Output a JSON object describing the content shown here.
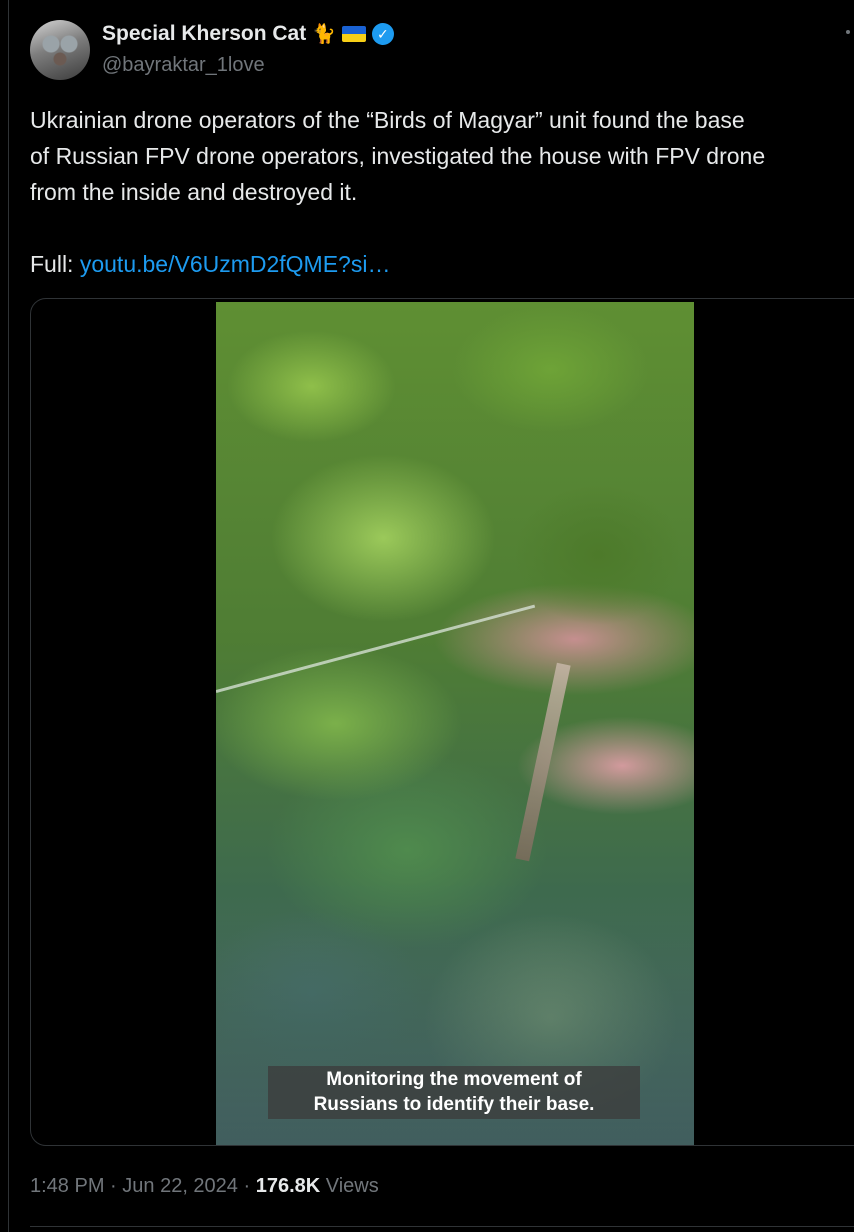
{
  "author": {
    "display_name": "Special Kherson Cat",
    "emoji": "🐈",
    "flag": "ukraine",
    "verified": true,
    "handle": "@bayraktar_1love"
  },
  "tweet": {
    "text_lines": [
      "Ukrainian drone operators of the “Birds of Magyar” unit found the base",
      "of Russian FPV drone operators, investigated the house with FPV drone",
      "from the inside and destroyed it."
    ],
    "full_label": "Full: ",
    "link_text": "youtu.be/V6UzmD2fQME?si…"
  },
  "media": {
    "caption_lines": [
      "Monitoring the movement of",
      "Russians to identify their base."
    ]
  },
  "meta": {
    "time": "1:48 PM",
    "separator": " · ",
    "date": "Jun 22, 2024",
    "views_count": "176.8K",
    "views_label": " Views"
  },
  "colors": {
    "background": "#000000",
    "text": "#e7e9ea",
    "secondary": "#71767b",
    "link": "#1d9bf0",
    "verified_badge": "#1d9bf0",
    "border": "#2f3336"
  }
}
